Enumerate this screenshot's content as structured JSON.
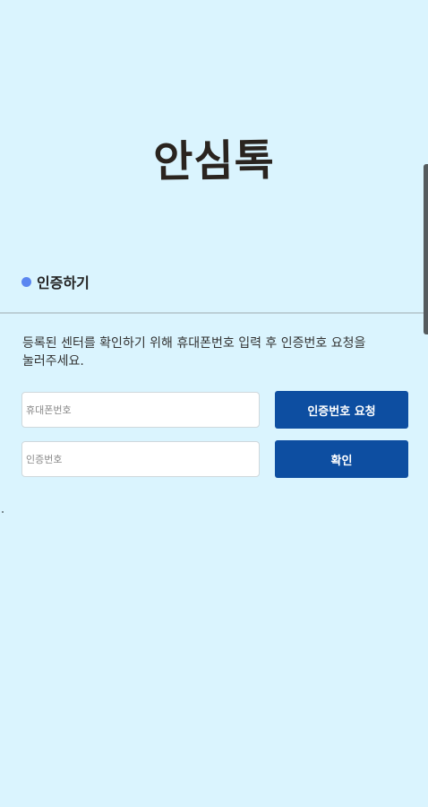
{
  "app": {
    "title": "안심톡"
  },
  "section": {
    "label": "인증하기"
  },
  "instruction": "등록된 센터를 확인하기 위해 휴대폰번호 입력 후 인증번호 요청을 눌러주세요.",
  "form": {
    "phone_placeholder": "휴대폰번호",
    "phone_value": "",
    "code_placeholder": "인증번호",
    "code_value": "",
    "request_button": "인증번호 요청",
    "confirm_button": "확인"
  },
  "colors": {
    "background": "#daf4fe",
    "accent_dot": "#5b86f0",
    "button": "#0d4ea1"
  }
}
